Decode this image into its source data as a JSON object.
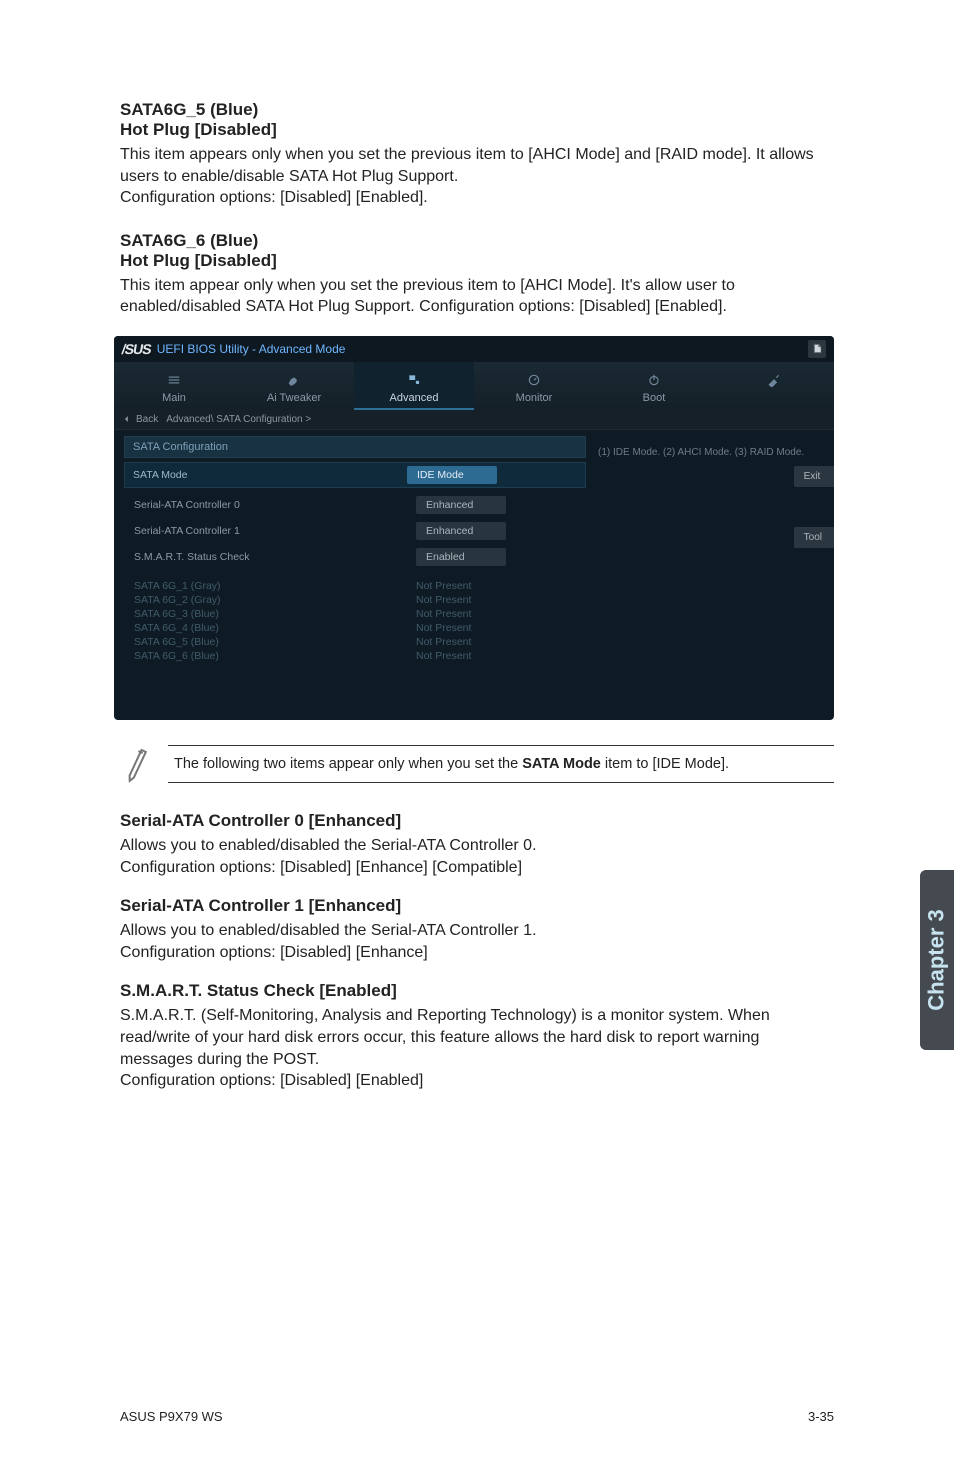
{
  "sections": {
    "sata5": {
      "name": "SATA6G_5 (Blue)",
      "sub": "Hot Plug [Disabled]",
      "desc1": "This item appears only when you set the previous item to [AHCI Mode] and [RAID mode]. It allows users to enable/disable SATA Hot Plug Support.",
      "desc2": "Configuration options: [Disabled] [Enabled]."
    },
    "sata6": {
      "name": "SATA6G_6 (Blue)",
      "sub": "Hot Plug [Disabled]",
      "desc": "This item appear only when you set the previous item to [AHCI Mode]. It's allow user to enabled/disabled SATA Hot Plug Support. Configuration options: [Disabled] [Enabled]."
    },
    "serial0": {
      "heading": "Serial-ATA Controller 0 [Enhanced]",
      "line1": "Allows you to enabled/disabled the Serial-ATA Controller 0.",
      "line2": "Configuration options: [Disabled] [Enhance] [Compatible]"
    },
    "serial1": {
      "heading": "Serial-ATA Controller 1 [Enhanced]",
      "line1": "Allows you to enabled/disabled the Serial-ATA Controller 1.",
      "line2": "Configuration options: [Disabled] [Enhance]"
    },
    "smart": {
      "heading": "S.M.A.R.T. Status Check [Enabled]",
      "line1": "S.M.A.R.T. (Self-Monitoring, Analysis and Reporting Technology) is a monitor system. When read/write of your hard disk errors occur, this feature allows the hard disk to report warning messages during the POST.",
      "line2": "Configuration options: [Disabled] [Enabled]"
    }
  },
  "bios": {
    "logo": "/SUS",
    "title": "UEFI BIOS Utility - Advanced Mode",
    "tabs": [
      "Main",
      "Ai  Tweaker",
      "Advanced",
      "Monitor",
      "Boot",
      ""
    ],
    "breadcrumb": {
      "back": "Back",
      "path": "Advanced\\ SATA Configuration  >"
    },
    "config": {
      "header": "SATA Configuration",
      "rows": [
        {
          "label": "SATA Mode",
          "value": "IDE Mode"
        },
        {
          "label": "Serial-ATA Controller 0",
          "value": "Enhanced"
        },
        {
          "label": "Serial-ATA Controller 1",
          "value": "Enhanced"
        },
        {
          "label": "S.M.A.R.T. Status Check",
          "value": "Enabled"
        }
      ]
    },
    "ports": [
      {
        "label": "SATA 6G_1 (Gray)",
        "value": "Not Present"
      },
      {
        "label": "SATA 6G_2 (Gray)",
        "value": "Not Present"
      },
      {
        "label": "SATA 6G_3 (Blue)",
        "value": "Not Present"
      },
      {
        "label": "SATA 6G_4 (Blue)",
        "value": "Not Present"
      },
      {
        "label": "SATA 6G_5 (Blue)",
        "value": "Not Present"
      },
      {
        "label": "SATA 6G_6 (Blue)",
        "value": "Not Present"
      }
    ],
    "help_text": "(1) IDE Mode. (2) AHCI Mode. (3) RAID Mode.",
    "side_buttons": [
      "Exit",
      "Tool"
    ]
  },
  "note": {
    "prefix": "The following two items appear only when you set the ",
    "bold": "SATA Mode",
    "suffix": " item to [IDE Mode]."
  },
  "chapter_label": "Chapter 3",
  "footer": {
    "left": "ASUS P9X79 WS",
    "right": "3-35"
  }
}
